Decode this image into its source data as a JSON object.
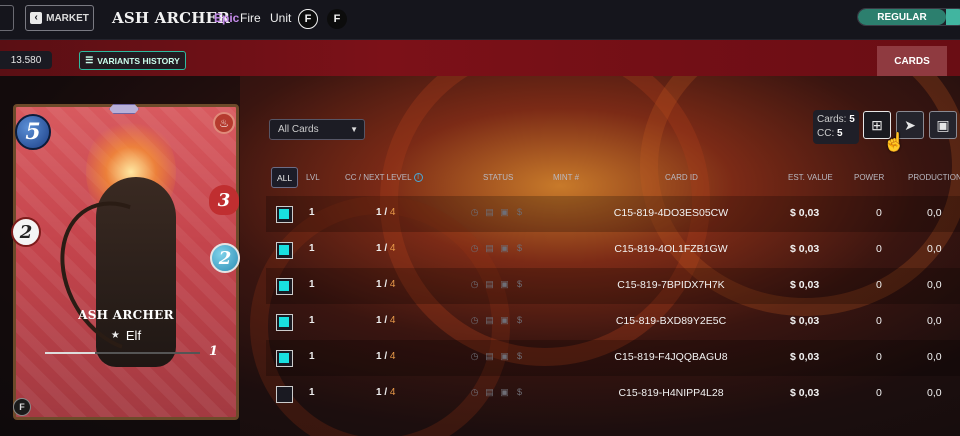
{
  "header": {
    "market_label": "MARKET",
    "card_name": "ASH ARCHER",
    "rarity": "Epic",
    "element": "Fire",
    "type": "Unit",
    "edition_glyph": "F",
    "toggle_label": "REGULAR"
  },
  "subheader": {
    "dec_value": "13.580",
    "variants_label": "VARIANTS HISTORY",
    "cards_tab": "CARDS"
  },
  "card_art": {
    "mana": "5",
    "ranged_attack": "2",
    "health": "3",
    "speed": "2",
    "name": "ASH ARCHER",
    "race": "Elf",
    "level": "1",
    "xp_fraction": 0.32,
    "edition_glyph": "F"
  },
  "filter": {
    "selected": "All Cards"
  },
  "summary": {
    "cards_label": "Cards:",
    "cards_count": "5",
    "cc_label": "CC:",
    "cc_count": "5"
  },
  "table": {
    "headers": {
      "all": "ALL",
      "lvl": "LVL",
      "cc": "CC / NEXT LEVEL",
      "status": "STATUS",
      "mint": "MINT #",
      "card_id": "CARD ID",
      "est_value": "EST. VALUE",
      "power": "POWER",
      "production": "PRODUCTION"
    },
    "rows": [
      {
        "checked": true,
        "lvl": "1",
        "cc": "1",
        "next": "4",
        "card_id": "C15-819-4DO3ES05CW",
        "value": "$ 0,03",
        "power": "0",
        "production": "0,0"
      },
      {
        "checked": true,
        "lvl": "1",
        "cc": "1",
        "next": "4",
        "card_id": "C15-819-4OL1FZB1GW",
        "value": "$ 0,03",
        "power": "0",
        "production": "0,0"
      },
      {
        "checked": true,
        "lvl": "1",
        "cc": "1",
        "next": "4",
        "card_id": "C15-819-7BPIDX7H7K",
        "value": "$ 0,03",
        "power": "0",
        "production": "0,0"
      },
      {
        "checked": true,
        "lvl": "1",
        "cc": "1",
        "next": "4",
        "card_id": "C15-819-BXD89Y2E5C",
        "value": "$ 0,03",
        "power": "0",
        "production": "0,0"
      },
      {
        "checked": true,
        "lvl": "1",
        "cc": "1",
        "next": "4",
        "card_id": "C15-819-F4JQQBAGU8",
        "value": "$ 0,03",
        "power": "0",
        "production": "0,0"
      },
      {
        "checked": false,
        "lvl": "1",
        "cc": "1",
        "next": "4",
        "card_id": "C15-819-H4NIPP4L28",
        "value": "$ 0,03",
        "power": "0",
        "production": "0,0"
      }
    ]
  },
  "colors": {
    "accent_teal": "#2c7f6e",
    "checkbox_cyan": "#19e0e0",
    "rarity_epic": "#c48ae8",
    "next_level_orange": "#e89a4a"
  }
}
